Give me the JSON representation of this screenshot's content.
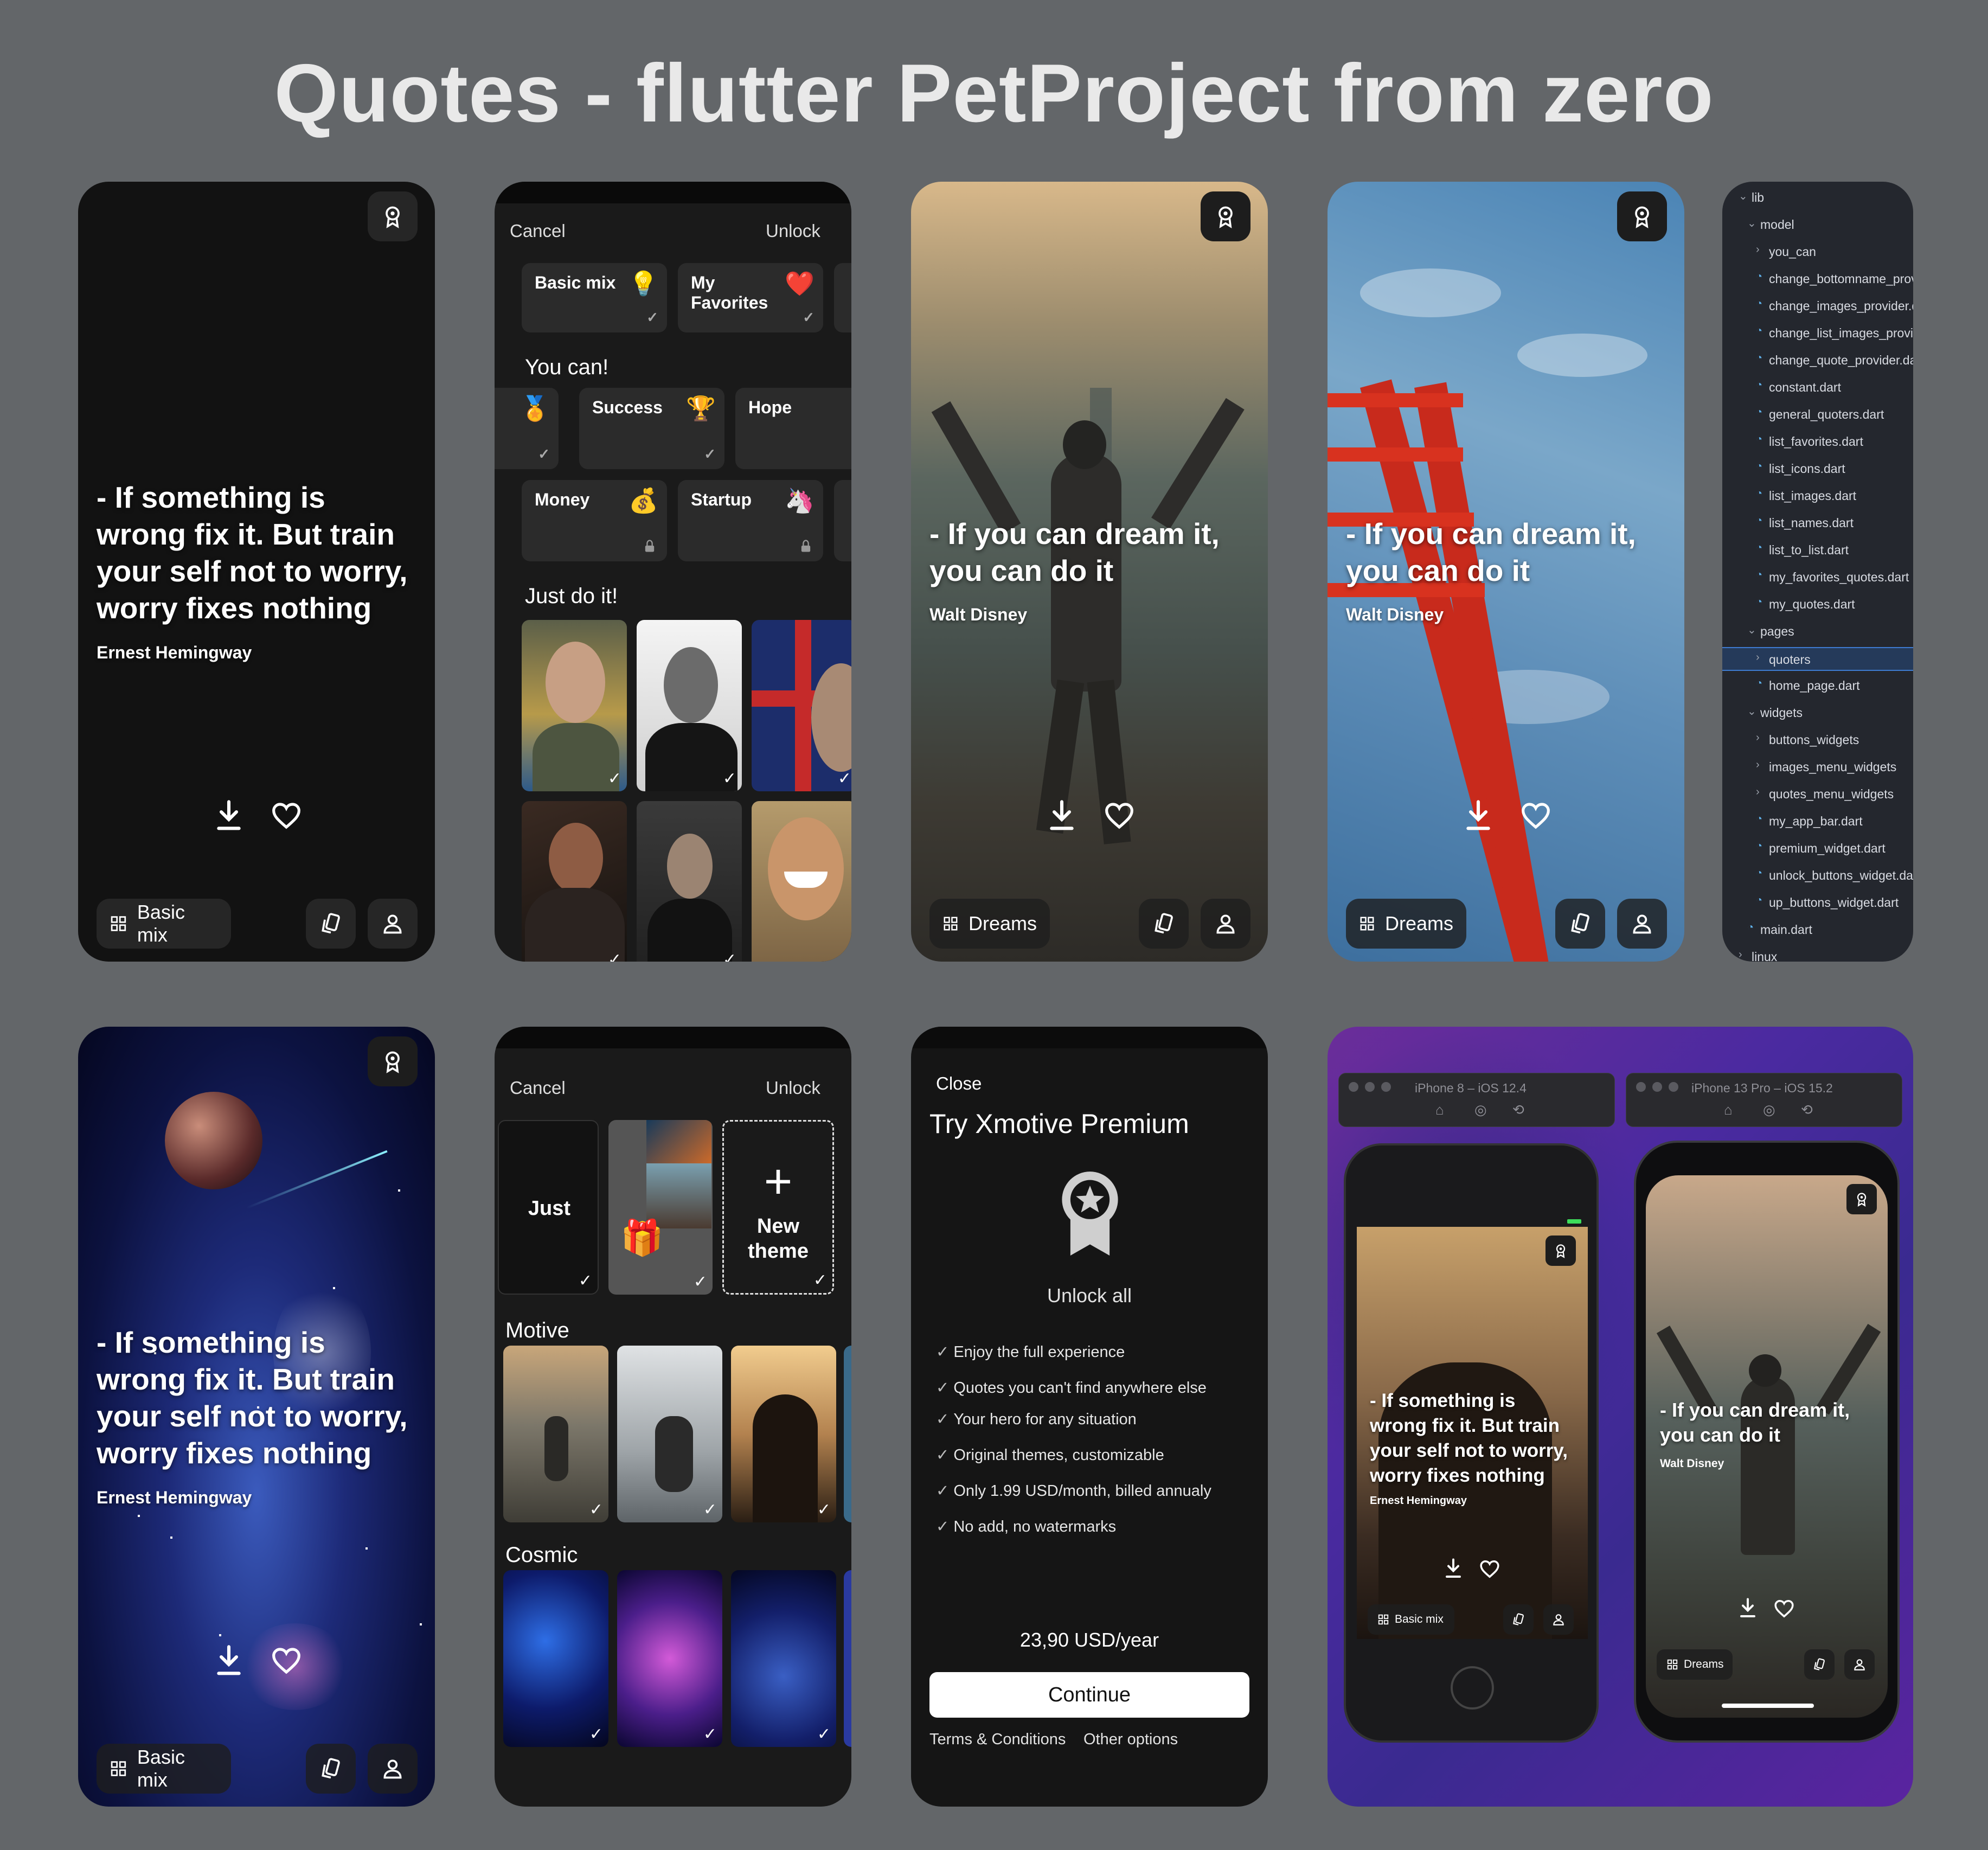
{
  "title": "Quotes - flutter PetProject from zero",
  "quotes": {
    "hemingway": {
      "text": "- If something is wrong fix it. But train your self not to worry, worry fixes nothing",
      "author": "Ernest Hemingway"
    },
    "disney": {
      "text": "- If you can dream it, you can do it",
      "author": "Walt Disney"
    }
  },
  "nav": {
    "basic_mix": "Basic mix",
    "dreams": "Dreams"
  },
  "icons": [
    "award-icon",
    "download-icon",
    "heart-icon",
    "grid-icon",
    "cards-icon",
    "person-icon"
  ],
  "picker": {
    "cancel": "Cancel",
    "unlock": "Unlock",
    "top_cards": [
      {
        "label": "Basic mix",
        "emoji": "💡"
      },
      {
        "label": "My Favorites",
        "emoji": "❤️"
      }
    ],
    "you_can_title": "You can!",
    "you_can_cards": [
      {
        "label": "Success",
        "emoji": "🏆"
      },
      {
        "label": "Hope",
        "emoji": "🌅"
      }
    ],
    "row3_cards": [
      {
        "label": "Money",
        "emoji": "💰"
      },
      {
        "label": "Startup",
        "emoji": "🦄"
      }
    ],
    "just_do_it_title": "Just do it!"
  },
  "themes": {
    "cancel": "Cancel",
    "unlock": "Unlock",
    "just": "Just",
    "new_theme": "New theme",
    "motive_title": "Motive",
    "cosmic_title": "Cosmic"
  },
  "premium": {
    "close": "Close",
    "title": "Try Xmotive Premium",
    "unlock_all": "Unlock all",
    "features": [
      "Enjoy the full experience",
      "Quotes you can't find anywhere else",
      "Your hero for any situation",
      "Original themes, customizable",
      "Only 1.99 USD/month, billed annualy",
      "No add, no watermarks"
    ],
    "price": "23,90 USD/year",
    "continue": "Continue",
    "terms": "Terms & Conditions",
    "other": "Other options"
  },
  "filetree": [
    {
      "label": "lib",
      "depth": 0,
      "kind": "folder"
    },
    {
      "label": "model",
      "depth": 1,
      "kind": "folder"
    },
    {
      "label": "you_can",
      "depth": 2,
      "kind": "folder-closed"
    },
    {
      "label": "change_bottomname_provider.",
      "depth": 2,
      "kind": "file"
    },
    {
      "label": "change_images_provider.dart",
      "depth": 2,
      "kind": "file"
    },
    {
      "label": "change_list_images_provider.d",
      "depth": 2,
      "kind": "file"
    },
    {
      "label": "change_quote_provider.dart",
      "depth": 2,
      "kind": "file"
    },
    {
      "label": "constant.dart",
      "depth": 2,
      "kind": "file"
    },
    {
      "label": "general_quoters.dart",
      "depth": 2,
      "kind": "file"
    },
    {
      "label": "list_favorites.dart",
      "depth": 2,
      "kind": "file"
    },
    {
      "label": "list_icons.dart",
      "depth": 2,
      "kind": "file"
    },
    {
      "label": "list_images.dart",
      "depth": 2,
      "kind": "file"
    },
    {
      "label": "list_names.dart",
      "depth": 2,
      "kind": "file"
    },
    {
      "label": "list_to_list.dart",
      "depth": 2,
      "kind": "file"
    },
    {
      "label": "my_favorites_quotes.dart",
      "depth": 2,
      "kind": "file"
    },
    {
      "label": "my_quotes.dart",
      "depth": 2,
      "kind": "file"
    },
    {
      "label": "pages",
      "depth": 1,
      "kind": "folder"
    },
    {
      "label": "quoters",
      "depth": 2,
      "kind": "folder-closed",
      "selected": true
    },
    {
      "label": "home_page.dart",
      "depth": 2,
      "kind": "file"
    },
    {
      "label": "widgets",
      "depth": 1,
      "kind": "folder"
    },
    {
      "label": "buttons_widgets",
      "depth": 2,
      "kind": "folder-closed"
    },
    {
      "label": "images_menu_widgets",
      "depth": 2,
      "kind": "folder-closed"
    },
    {
      "label": "quotes_menu_widgets",
      "depth": 2,
      "kind": "folder-closed"
    },
    {
      "label": "my_app_bar.dart",
      "depth": 2,
      "kind": "file"
    },
    {
      "label": "premium_widget.dart",
      "depth": 2,
      "kind": "file"
    },
    {
      "label": "unlock_buttons_widget.dart",
      "depth": 2,
      "kind": "file"
    },
    {
      "label": "up_buttons_widget.dart",
      "depth": 2,
      "kind": "file"
    },
    {
      "label": "main.dart",
      "depth": 1,
      "kind": "file"
    },
    {
      "label": "linux",
      "depth": 0,
      "kind": "folder-closed"
    }
  ],
  "simulators": {
    "left_title": "iPhone 8 – iOS 12.4",
    "right_title": "iPhone 13 Pro – iOS 15.2",
    "left_quote": "- If something is wrong fix it. But train your self not to worry, worry fixes nothing",
    "left_author": "Ernest Hemingway",
    "right_quote": "- If you can dream it, you can do it",
    "right_author": "Walt Disney"
  }
}
